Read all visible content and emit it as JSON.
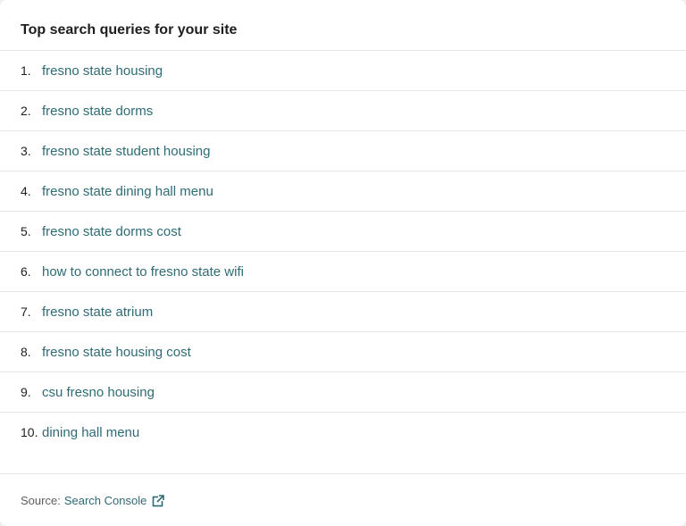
{
  "card": {
    "title": "Top search queries for your site"
  },
  "queries": [
    {
      "num": "1.",
      "text": "fresno state housing"
    },
    {
      "num": "2.",
      "text": "fresno state dorms"
    },
    {
      "num": "3.",
      "text": "fresno state student housing"
    },
    {
      "num": "4.",
      "text": "fresno state dining hall menu"
    },
    {
      "num": "5.",
      "text": "fresno state dorms cost"
    },
    {
      "num": "6.",
      "text": "how to connect to fresno state wifi"
    },
    {
      "num": "7.",
      "text": "fresno state atrium"
    },
    {
      "num": "8.",
      "text": "fresno state housing cost"
    },
    {
      "num": "9.",
      "text": "csu fresno housing"
    },
    {
      "num": "10.",
      "text": "dining hall menu"
    }
  ],
  "footer": {
    "source_label": "Source:",
    "source_link": "Search Console",
    "icon": "external-link-icon"
  },
  "colors": {
    "link": "#2e6b75",
    "text": "#1e1e1e",
    "divider": "#e6e6e6"
  }
}
